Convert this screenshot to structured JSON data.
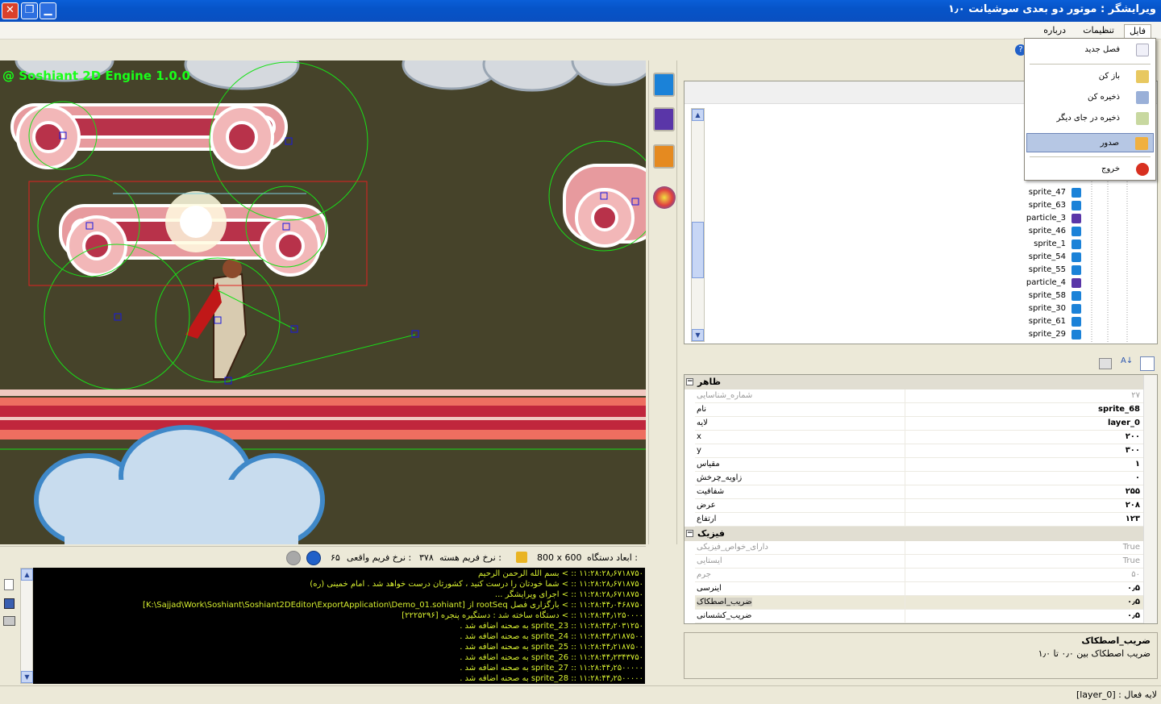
{
  "window": {
    "title": "ویرایشگر : موتور دو بعدی سوشیانت ۱٫۰"
  },
  "menubar": {
    "file": "فایل",
    "settings": "تنظیمات",
    "about": "درباره"
  },
  "file_menu": {
    "new_chapter": "فصل جدید",
    "open": "باز کن",
    "save": "ذخیره کن",
    "save_as": "ذخیره در جای دیگر",
    "export": "صدور",
    "exit": "خروج"
  },
  "scene": {
    "engine_label": "@ Soshiant 2D Engine 1.0.0"
  },
  "object_list": [
    {
      "name": "sprite_47",
      "kind": "sprite"
    },
    {
      "name": "sprite_63",
      "kind": "sprite"
    },
    {
      "name": "particle_3",
      "kind": "particle"
    },
    {
      "name": "sprite_46",
      "kind": "sprite"
    },
    {
      "name": "sprite_1",
      "kind": "sprite"
    },
    {
      "name": "sprite_54",
      "kind": "sprite"
    },
    {
      "name": "sprite_55",
      "kind": "sprite"
    },
    {
      "name": "particle_4",
      "kind": "particle"
    },
    {
      "name": "sprite_58",
      "kind": "sprite"
    },
    {
      "name": "sprite_30",
      "kind": "sprite"
    },
    {
      "name": "sprite_61",
      "kind": "sprite"
    },
    {
      "name": "sprite_29",
      "kind": "sprite"
    }
  ],
  "properties": {
    "cat_appearance": "ظاهر",
    "cat_physics": "فیزیک",
    "appearance": [
      {
        "name": "شماره_شناسایی",
        "value": "۲۷",
        "dim": true
      },
      {
        "name": "نام",
        "value": "sprite_68"
      },
      {
        "name": "لایه",
        "value": "layer_0"
      },
      {
        "name": "x",
        "value": "۲۰۰"
      },
      {
        "name": "y",
        "value": "۳۰۰"
      },
      {
        "name": "مقیاس",
        "value": "۱"
      },
      {
        "name": "زاویه_چرخش",
        "value": "۰"
      },
      {
        "name": "شفافیت",
        "value": "۲۵۵"
      },
      {
        "name": "عرض",
        "value": "۲۰۸"
      },
      {
        "name": "ارتفاع",
        "value": "۱۲۳"
      }
    ],
    "physics": [
      {
        "name": "دارای_خواص_فیزیکی",
        "value": "True",
        "dim": true
      },
      {
        "name": "ایستایی",
        "value": "True",
        "dim": true
      },
      {
        "name": "جرم",
        "value": "۵۰",
        "dim": true
      },
      {
        "name": "اینرسی",
        "value": "۰٫۵"
      },
      {
        "name": "ضریب_اصطکاک",
        "value": "۰٫۵",
        "selected": true
      },
      {
        "name": "ضریب_کشسانی",
        "value": "۰٫۵"
      }
    ]
  },
  "description": {
    "title": "ضریب_اصطکاک",
    "text": "ضریب اصطکاک بین ۰٫۰ تا ۱٫۰"
  },
  "scene_status": {
    "device_label": "ابعاد دستگاه :",
    "device_value": "800 x 600",
    "core_fps_label": "نرخ فریم هسته :",
    "core_fps_value": "۳۷۸",
    "real_fps_label": "نرخ فریم واقعی :",
    "real_fps_value": "۶۵"
  },
  "console": [
    "۱۱:۲۸:۲۸٫۶۷۱۸۷۵۰ :: > بسم الله الرحمن الرحیم",
    "۱۱:۲۸:۲۸٫۶۷۱۸۷۵۰ :: > شما خودتان را درست کنید ، کشورتان درست خواهد شد . امام خمینی (ره)",
    "۱۱:۲۸:۲۸٫۶۷۱۸۷۵۰ :: > اجرای ویرایشگر ...",
    "۱۱:۲۸:۴۴٫۰۴۶۸۷۵۰ :: > بارگزاری فصل rootSeq از [K:\\Sajjad\\Work\\Soshiant\\Soshiant2DEditor\\ExportApplication\\Demo_01.sohiant]",
    "۱۱:۲۸:۴۴٫۱۲۵۰۰۰۰ :: > دستگاه ساخته شد : دستگیره پنجره [۲۲۲۵۲۹۶]",
    "۱۱:۲۸:۴۴٫۲۰۳۱۲۵۰ :: sprite_23  به صحنه اضافه شد .",
    "۱۱:۲۸:۴۴٫۲۱۸۷۵۰۰ :: sprite_24  به صحنه اضافه شد .",
    "۱۱:۲۸:۴۴٫۲۱۸۷۵۰۰ :: sprite_25  به صحنه اضافه شد .",
    "۱۱:۲۸:۴۴٫۲۳۴۳۷۵۰ :: sprite_26  به صحنه اضافه شد .",
    "۱۱:۲۸:۴۴٫۲۵۰۰۰۰۰ :: sprite_27  به صحنه اضافه شد .",
    "۱۱:۲۸:۴۴٫۲۵۰۰۰۰۰ :: sprite_28  به صحنه اضافه شد ."
  ],
  "statusbar": {
    "active_layer": "لایه فعال : [layer_0]"
  },
  "colors": {
    "titlebar": "#0654c8",
    "console_text": "#d8f030",
    "scene_bg": "#46432a",
    "engine_label": "#19ff19"
  }
}
